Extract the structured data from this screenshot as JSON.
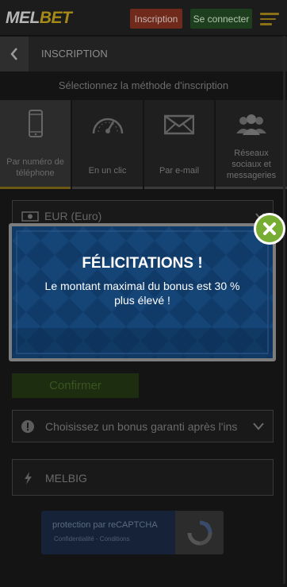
{
  "header": {
    "logo_part1": "MEL",
    "logo_part2": "BET",
    "register_label": "Inscription",
    "login_label": "Se connecter"
  },
  "page": {
    "title": "INSCRIPTION",
    "subtitle": "Sélectionnez la méthode d'inscription"
  },
  "methods": [
    {
      "label_line1": "Par numéro de",
      "label_line2": "téléphone",
      "icon": "phone-icon"
    },
    {
      "label_line1": "En un clic",
      "icon": "speedometer-icon"
    },
    {
      "label_line1": "Par e-mail",
      "icon": "envelope-icon"
    },
    {
      "label_line1": "Réseaux",
      "label_line2": "sociaux et",
      "label_line3": "messageries",
      "icon": "users-icon"
    }
  ],
  "form": {
    "currency_value": "EUR (Euro)",
    "confirm_label": "Confirmer",
    "bonus_placeholder": "Choisissez un bonus garanti après l'ins",
    "promo_code_value": "MELBIG"
  },
  "recaptcha": {
    "line1": "protection par reCAPTCHA",
    "line2": "Confidentialité - Conditions"
  },
  "modal": {
    "title": "FÉLICITATIONS !",
    "message_line1": "Le montant maximal du bonus est 30 %",
    "message_line2": "plus élevé !"
  },
  "colors": {
    "accent": "#a58a18",
    "modal_bg": "#0f3a6a",
    "close_button": "#77ad33"
  }
}
